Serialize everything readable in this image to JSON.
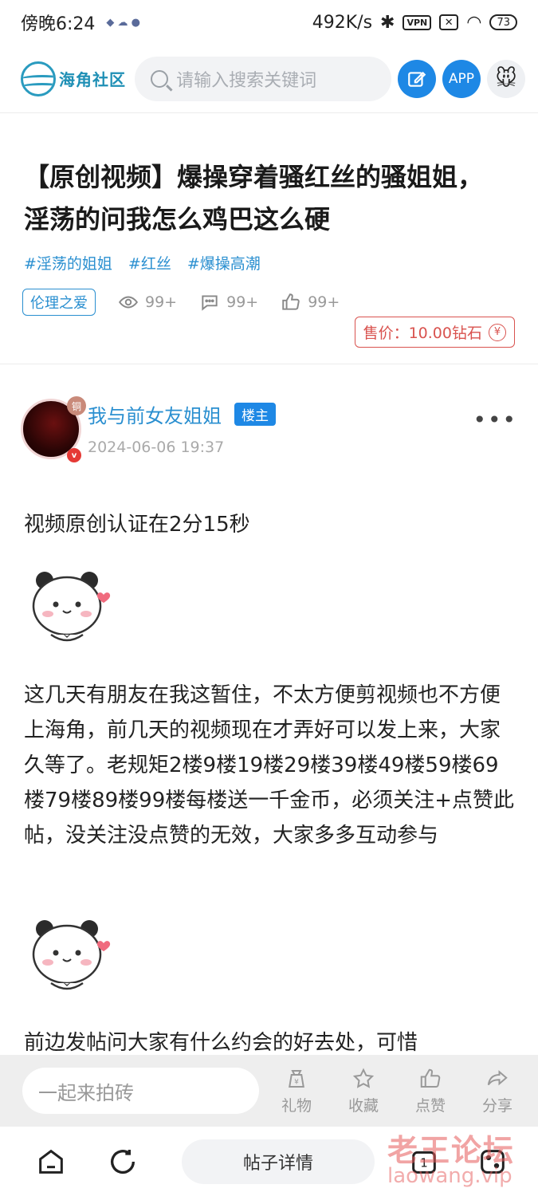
{
  "status_bar": {
    "time": "傍晚6:24",
    "speed": "492K/s",
    "vpn": "VPN",
    "battery": "73"
  },
  "header": {
    "logo_text": "海角社区",
    "search_placeholder": "请输入搜索关键词",
    "app_label": "APP"
  },
  "post": {
    "title": "【原创视频】爆操穿着骚红丝的骚姐姐，淫荡的问我怎么鸡巴这么硬",
    "tags": [
      "#淫荡的姐姐",
      "#红丝",
      "#爆操高潮"
    ],
    "category": "伦理之爱",
    "views": "99+",
    "comments": "99+",
    "likes": "99+",
    "price": "售价：10.00钻石",
    "price_icon": "¥",
    "author": "我与前女友姐姐",
    "author_role": "楼主",
    "author_level": "铜",
    "author_verify": "v",
    "time": "2024-06-06 19:37",
    "paragraphs": [
      "视频原创认证在2分15秒",
      "这几天有朋友在我这暂住，不太方便剪视频也不方便上海角，前几天的视频现在才弄好可以发上来，大家久等了。老规矩2楼9楼19楼29楼39楼49楼59楼69楼79楼89楼99楼每楼送一千金币，必须关注+点赞此帖，没关注没点赞的无效，大家多多互动参与",
      "前边发帖问大家有什么约会的好去处，可惜"
    ]
  },
  "bottom_bar": {
    "input_placeholder": "一起来拍砖",
    "actions": [
      "礼物",
      "收藏",
      "点赞",
      "分享"
    ]
  },
  "nav": {
    "detail_label": "帖子详情",
    "page_count": "1"
  },
  "watermark": {
    "main": "老王论坛",
    "sub": "laowang.vip"
  },
  "colors": {
    "accent": "#1e88e5",
    "link": "#2a8fd0",
    "price": "#d9534f"
  }
}
